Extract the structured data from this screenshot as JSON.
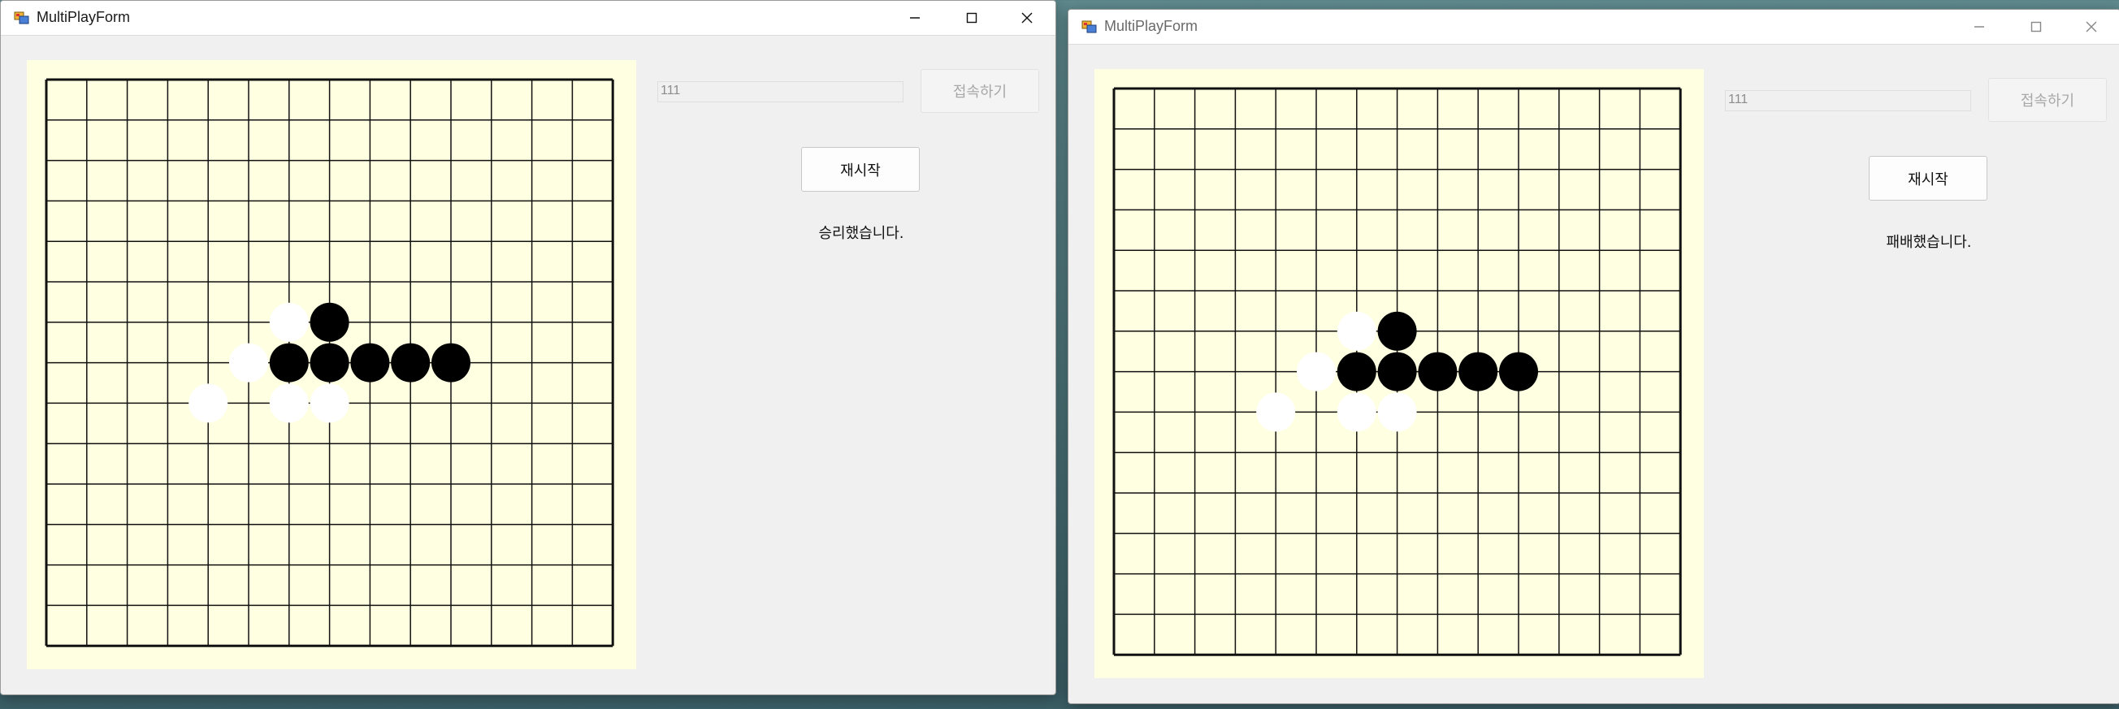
{
  "windows": [
    {
      "id": "left",
      "title": "MultiPlayForm",
      "address": "111",
      "connect_label": "접속하기",
      "restart_label": "재시작",
      "status": "승리했습니다."
    },
    {
      "id": "right",
      "title": "MultiPlayForm",
      "address": "111",
      "connect_label": "접속하기",
      "restart_label": "재시작",
      "status": "패배했습니다."
    }
  ],
  "board": {
    "lines": 15,
    "background": "#ffffe1",
    "black_stones": [
      [
        7,
        6
      ],
      [
        6,
        7
      ],
      [
        7,
        7
      ],
      [
        8,
        7
      ],
      [
        9,
        7
      ],
      [
        10,
        7
      ]
    ],
    "white_stones": [
      [
        6,
        6
      ],
      [
        5,
        7
      ],
      [
        4,
        8
      ],
      [
        6,
        8
      ],
      [
        7,
        8
      ]
    ]
  },
  "colors": {
    "window_bg": "#f0f0f0",
    "board_bg": "#ffffe1",
    "black_stone": "#000000",
    "white_stone": "#ffffff"
  },
  "icons": {
    "app": "app-window-icon",
    "minimize": "minimize-icon",
    "maximize": "maximize-icon",
    "close": "close-icon"
  }
}
